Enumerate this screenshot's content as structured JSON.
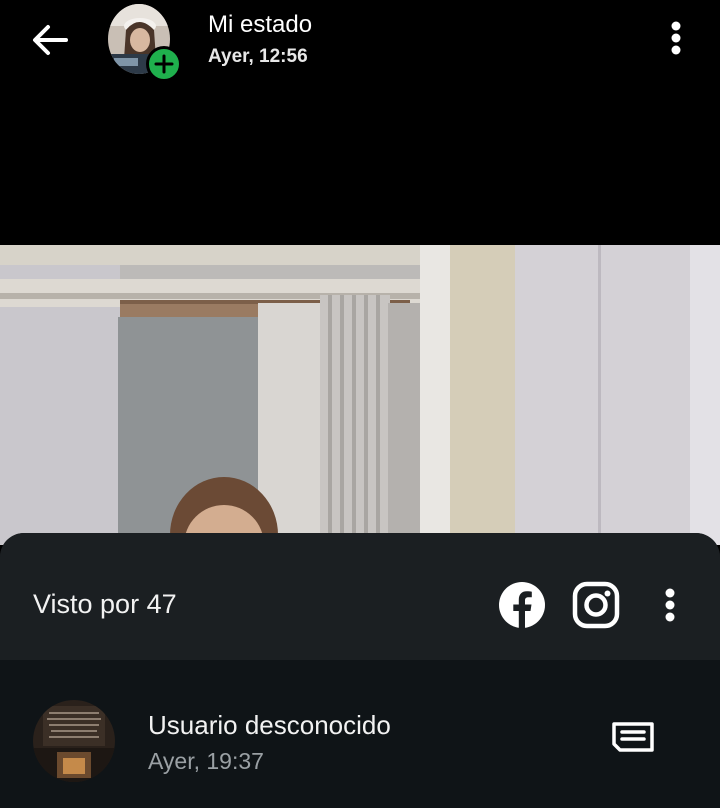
{
  "header": {
    "title": "Mi estado",
    "subtitle": "Ayer, 12:56",
    "back_icon": "arrow-left-icon",
    "menu_icon": "more-vertical-icon",
    "add_icon": "plus-icon"
  },
  "sheet": {
    "viewed_label": "Visto por 47",
    "share_targets": [
      "facebook-icon",
      "instagram-icon"
    ],
    "menu_icon": "more-vertical-icon"
  },
  "viewers": [
    {
      "name": "Usuario desconocido",
      "time": "Ayer, 19:37",
      "action_icon": "reply-message-icon"
    }
  ],
  "colors": {
    "background": "#000000",
    "sheet": "#1b1f22",
    "list": "#0f1417",
    "accent_green": "#1fb04d",
    "muted_text": "#9aa0a4"
  }
}
